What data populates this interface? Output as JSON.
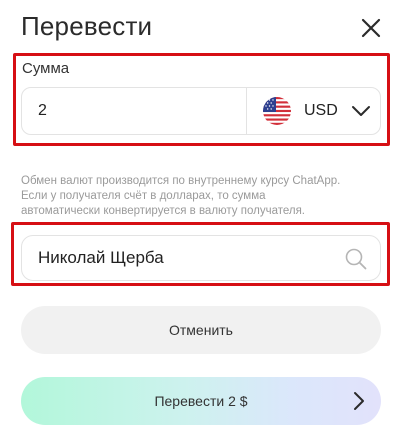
{
  "header": {
    "title": "Перевести"
  },
  "amount": {
    "label": "Сумма",
    "value": "2",
    "currency": "USD"
  },
  "info": {
    "lines": [
      "Обмен валют производится по внутреннему курсу ChatApp.",
      "Если у получателя счёт в долларах, то сумма",
      "автоматически конвертируется в валюту получателя."
    ]
  },
  "recipient": {
    "value": "Николай Щерба"
  },
  "buttons": {
    "cancel_label": "Отменить",
    "transfer_label": "Перевести 2 $"
  },
  "colors": {
    "highlight": "#d60f14",
    "gradient_start": "#b2f7da",
    "gradient_end": "#e2e2fb"
  },
  "icons": {
    "close": "close-icon",
    "flag": "us-flag-icon",
    "dropdown": "chevron-down-icon",
    "search": "search-icon",
    "arrow": "chevron-right-icon"
  }
}
